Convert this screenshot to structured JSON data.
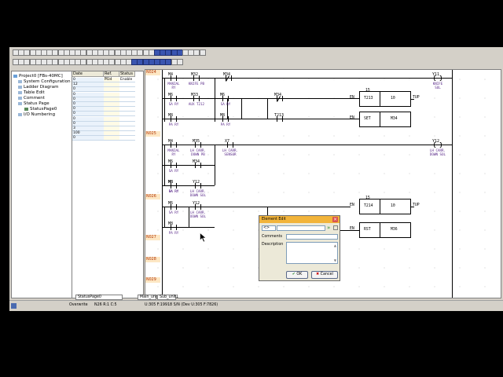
{
  "tree": {
    "items": [
      {
        "label": "Project0 [FBs-40MC]",
        "level": 0
      },
      {
        "label": "System Configuration",
        "level": 1
      },
      {
        "label": "Ladder Diagram",
        "level": 1
      },
      {
        "label": "Table Edit",
        "level": 1
      },
      {
        "label": "Comment",
        "level": 1
      },
      {
        "label": "Status Page",
        "level": 1
      },
      {
        "label": "StatusPage0",
        "level": 2
      },
      {
        "label": "I/O Numbering",
        "level": 1
      }
    ]
  },
  "status_page": {
    "headers": [
      "Date",
      "Ref. No.",
      "Status"
    ],
    "rows": [
      {
        "date": "0",
        "ref": "M34",
        "status": "Enable"
      },
      {
        "date": "12",
        "ref": "",
        "status": ""
      },
      {
        "date": "0",
        "ref": "",
        "status": ""
      },
      {
        "date": "0",
        "ref": "",
        "status": ""
      },
      {
        "date": "0",
        "ref": "",
        "status": ""
      },
      {
        "date": "0",
        "ref": "",
        "status": ""
      },
      {
        "date": "0",
        "ref": "",
        "status": ""
      },
      {
        "date": "0",
        "ref": "",
        "status": ""
      },
      {
        "date": "0",
        "ref": "",
        "status": ""
      },
      {
        "date": "0",
        "ref": "",
        "status": ""
      },
      {
        "date": "3",
        "ref": "",
        "status": ""
      },
      {
        "date": "100",
        "ref": "",
        "status": ""
      },
      {
        "date": "0",
        "ref": "",
        "status": ""
      }
    ],
    "tab_label": "StatusPage0"
  },
  "ladder": {
    "rungs": [
      "N024",
      "N025",
      "N026",
      "N027",
      "N028",
      "N029"
    ],
    "contacts": [
      {
        "ref": "M4",
        "comment": "MANIAL\nRY"
      },
      {
        "ref": "M32",
        "comment": "KNIFE PB"
      },
      {
        "ref": "M34",
        "comment": ""
      },
      {
        "ref": "M6",
        "comment": "SA RY"
      },
      {
        "ref": "M33",
        "comment": "AUX T212"
      },
      {
        "ref": "M6",
        "comment": "SA RY"
      },
      {
        "ref": "M34",
        "comment": ""
      },
      {
        "ref": "M8",
        "comment": "PA RY"
      },
      {
        "ref": "M8",
        "comment": "PA RY"
      },
      {
        "ref": "T213",
        "comment": ""
      },
      {
        "ref": "M4",
        "comment": "MANIAL\nRY"
      },
      {
        "ref": "M35",
        "comment": "LH CARR.\nDOWN PB"
      },
      {
        "ref": "X7",
        "comment": "LH CARR.\nSENSOR"
      },
      {
        "ref": "M6",
        "comment": "SA RY"
      },
      {
        "ref": "M6",
        "comment": "SA RY"
      },
      {
        "ref": "M34",
        "comment": ""
      },
      {
        "ref": "M8",
        "comment": "PA RY"
      },
      {
        "ref": "Y12",
        "comment": "LH CARR.\nDOWN SOL"
      },
      {
        "ref": "M6",
        "comment": "SA RY"
      },
      {
        "ref": "Y12",
        "comment": "LH CARR.\nDOWN SOL"
      },
      {
        "ref": "M8",
        "comment": "PA RY"
      }
    ],
    "coils": [
      {
        "ref": "Y11",
        "comment": "KNIFE\nSOL"
      },
      {
        "ref": "Y12",
        "comment": "LH CARR.\nDOWN SOL"
      }
    ],
    "blocks": [
      {
        "fn": "15",
        "op": "T213",
        "val": "10",
        "in": "EN",
        "out": "TUP"
      },
      {
        "fn": "",
        "op": "SET",
        "val": "M34",
        "in": "EN",
        "out": ""
      },
      {
        "fn": "15",
        "op": "T214",
        "val": "10",
        "in": "EN",
        "out": "TUP"
      },
      {
        "fn": "",
        "op": "RST",
        "val": "M36",
        "in": "EN",
        "out": ""
      }
    ]
  },
  "dialog": {
    "title": "Element Edit",
    "close": "×",
    "field_value": "<>",
    "comments_label": "Comments",
    "description_label": "Description",
    "ok": "OK",
    "cancel": "Cancel"
  },
  "bottom_tabs": [
    "Main_unit1",
    "Sub_unit1"
  ],
  "status": {
    "mode": "Overwrite",
    "pos": "N26 R:1 C:5",
    "info": "U:305 F:19918 S/N (Dev U:305 F:7826)"
  },
  "colors": {
    "rung_bg": "#fde7c4",
    "rung_text": "#b03000",
    "comment": "#5a2a8a",
    "dialog_title": "#f2b43a"
  }
}
